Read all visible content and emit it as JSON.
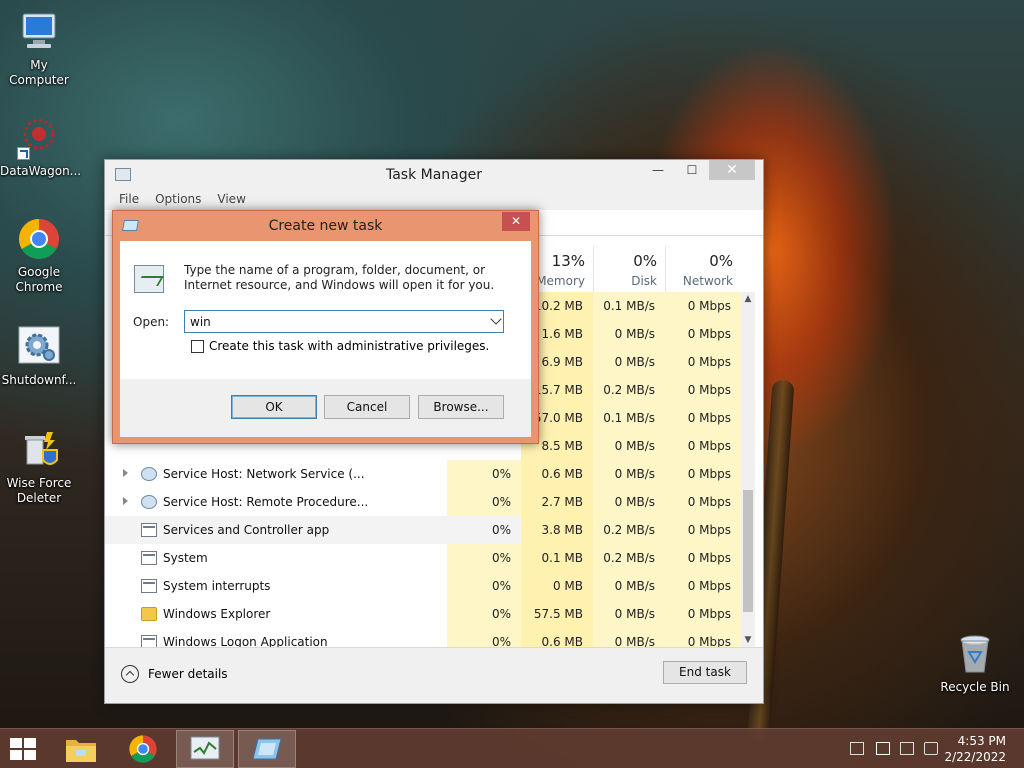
{
  "desktop": {
    "icons": [
      {
        "label": "My Computer"
      },
      {
        "label": "DataWagon..."
      },
      {
        "label": "Google Chrome"
      },
      {
        "label": "Shutdownf..."
      },
      {
        "label": "Wise Force Deleter"
      },
      {
        "label": "Recycle Bin"
      }
    ]
  },
  "task_manager": {
    "title": "Task Manager",
    "window_buttons": {
      "minimize": "—",
      "maximize": "☐",
      "close": "✕"
    },
    "menu": [
      "File",
      "Options",
      "View"
    ],
    "columns": [
      {
        "pct": "13%",
        "label": "Memory"
      },
      {
        "pct": "0%",
        "label": "Disk"
      },
      {
        "pct": "0%",
        "label": "Network"
      }
    ],
    "rows": [
      {
        "name": "",
        "cpu": "",
        "mem": "10.2 MB",
        "disk": "0.1 MB/s",
        "net": "0 Mbps"
      },
      {
        "name": "",
        "cpu": "",
        "mem": "1.6 MB",
        "disk": "0 MB/s",
        "net": "0 Mbps"
      },
      {
        "name": "",
        "cpu": "",
        "mem": "6.9 MB",
        "disk": "0 MB/s",
        "net": "0 Mbps"
      },
      {
        "name": "",
        "cpu": "",
        "mem": "15.7 MB",
        "disk": "0.2 MB/s",
        "net": "0 Mbps"
      },
      {
        "name": "",
        "cpu": "",
        "mem": "57.0 MB",
        "disk": "0.1 MB/s",
        "net": "0 Mbps"
      },
      {
        "name": "",
        "cpu": "",
        "mem": "8.5 MB",
        "disk": "0 MB/s",
        "net": "0 Mbps"
      },
      {
        "name": "Service Host: Network Service (...",
        "cpu": "0%",
        "mem": "0.6 MB",
        "disk": "0 MB/s",
        "net": "0 Mbps"
      },
      {
        "name": "Service Host: Remote Procedure...",
        "cpu": "0%",
        "mem": "2.7 MB",
        "disk": "0 MB/s",
        "net": "0 Mbps"
      },
      {
        "name": "Services and Controller app",
        "cpu": "0%",
        "mem": "3.8 MB",
        "disk": "0.2 MB/s",
        "net": "0 Mbps"
      },
      {
        "name": "System",
        "cpu": "0%",
        "mem": "0.1 MB",
        "disk": "0.2 MB/s",
        "net": "0 Mbps"
      },
      {
        "name": "System interrupts",
        "cpu": "0%",
        "mem": "0 MB",
        "disk": "0 MB/s",
        "net": "0 Mbps"
      },
      {
        "name": "Windows Explorer",
        "cpu": "0%",
        "mem": "57.5 MB",
        "disk": "0 MB/s",
        "net": "0 Mbps"
      },
      {
        "name": "Windows Logon Application",
        "cpu": "0%",
        "mem": "0.6 MB",
        "disk": "0 MB/s",
        "net": "0 Mbps"
      }
    ],
    "fewer_details": "Fewer details",
    "end_task": "End task"
  },
  "dialog": {
    "title": "Create new task",
    "close": "✕",
    "description": "Type the name of a program, folder, document, or Internet resource, and Windows will open it for you.",
    "open_label": "Open:",
    "open_value": "win",
    "admin_checkbox": "Create this task with administrative privileges.",
    "ok": "OK",
    "cancel": "Cancel",
    "browse": "Browse..."
  },
  "taskbar": {
    "time": "4:53 PM",
    "date": "2/22/2022"
  }
}
